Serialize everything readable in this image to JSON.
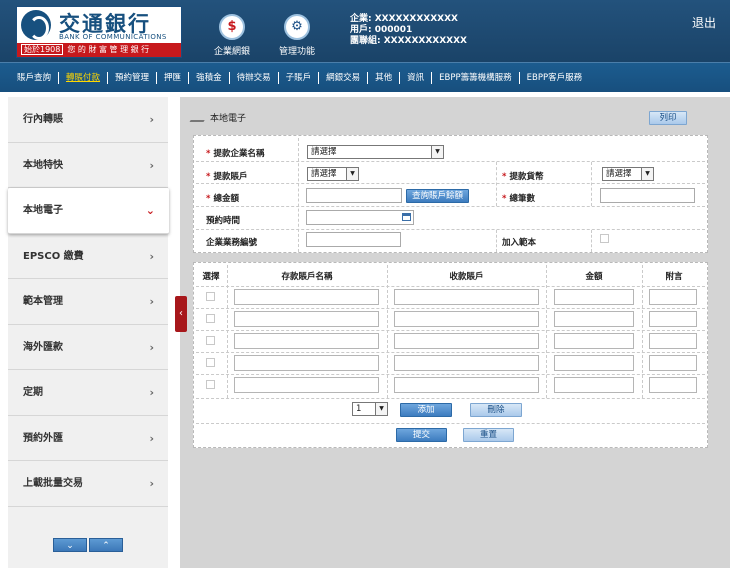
{
  "bank": {
    "name_cn": "交通銀行",
    "name_en": "BANK OF COMMUNICATIONS",
    "since": "始於1908",
    "slogan": "您 的 財 富 管 理 銀 行"
  },
  "header": {
    "icons": [
      {
        "label": "企業網銀",
        "icon": "monitor-icon"
      },
      {
        "label": "管理功能",
        "icon": "gears-icon"
      }
    ],
    "user": {
      "company": "企業: XXXXXXXXXXXX",
      "user": "用戶: 000001",
      "group": "團聯組: XXXXXXXXXXXX"
    },
    "logout": "退出"
  },
  "nav": [
    "賬戶查詢",
    "轉賬付款",
    "預約管理",
    "押匯",
    "強積金",
    "待辦交易",
    "子賬戶",
    "網銀交易",
    "其他",
    "資訊",
    "EBPP籌籌機構服務",
    "EBPP客戶服務"
  ],
  "nav_active": 1,
  "sidebar": [
    "行內轉賬",
    "本地特快",
    "本地電子",
    "EPSCO 繳費",
    "範本管理",
    "海外匯款",
    "定期",
    "預約外匯",
    "上載批量交易"
  ],
  "sidebar_active": 2,
  "page": {
    "title": "本地電子",
    "print": "列印"
  },
  "form": {
    "company_label": "提款企業名稱",
    "company_value": "請選擇",
    "account_label": "提款賬戶",
    "account_value": "請選擇",
    "currency_label": "提款貨幣",
    "currency_value": "請選擇",
    "total_label": "總金額",
    "query_btn": "查詢賬戶餘額",
    "count_label": "總筆數",
    "schedule_label": "預約時間",
    "ref_label": "企業業務編號",
    "template_label": "加入範本"
  },
  "grid": {
    "headers": [
      "選擇",
      "存款賬戶名稱",
      "收款賬戶",
      "金額",
      "附言"
    ],
    "rows": 5,
    "page_select": "1",
    "add": "添加",
    "delete": "刪除"
  },
  "actions": {
    "submit": "提交",
    "reset": "重置"
  },
  "colors": {
    "header": "#1f4f7b",
    "accent_red": "#c7191d",
    "button": "#3d7cbf",
    "active_nav": "#ffd800"
  }
}
